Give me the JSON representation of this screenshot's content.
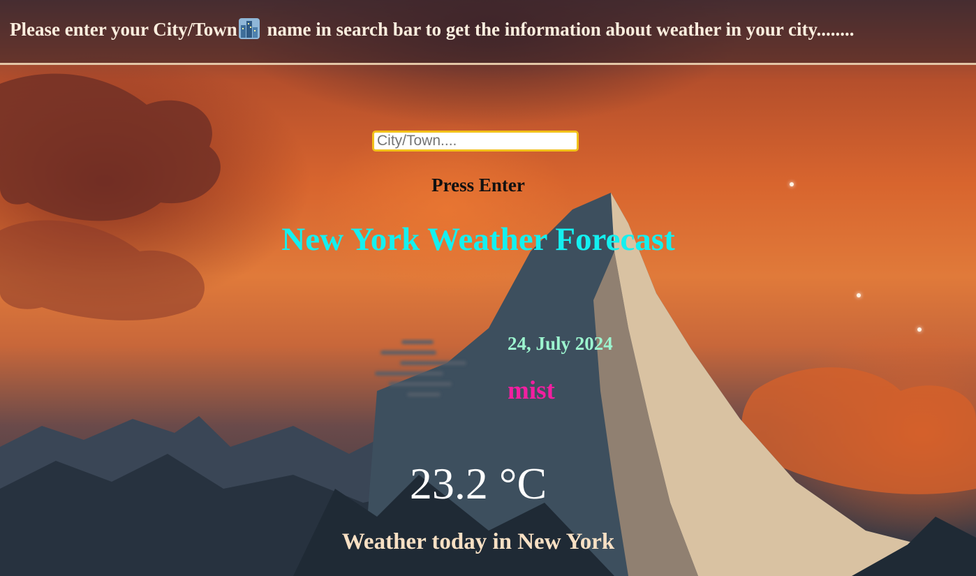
{
  "header": {
    "text_before_icon": "Please enter your City/Town",
    "icon": "city-buildings-icon",
    "text_after_icon": " name in search bar to get the information about weather in your city........"
  },
  "search": {
    "placeholder": "City/Town....",
    "value": ""
  },
  "instruction": "Press Enter",
  "forecast": {
    "title": "New York Weather Forecast",
    "date": "24, July 2024",
    "condition": "mist",
    "condition_icon": "mist-icon",
    "temperature": "23.2 °C",
    "summary": "Weather today in New York"
  },
  "colors": {
    "title": "#14f0f0",
    "date": "#9cf5cf",
    "condition": "#f21fa0",
    "search_border": "#f2c11a",
    "header_border": "#e3c6a6"
  }
}
